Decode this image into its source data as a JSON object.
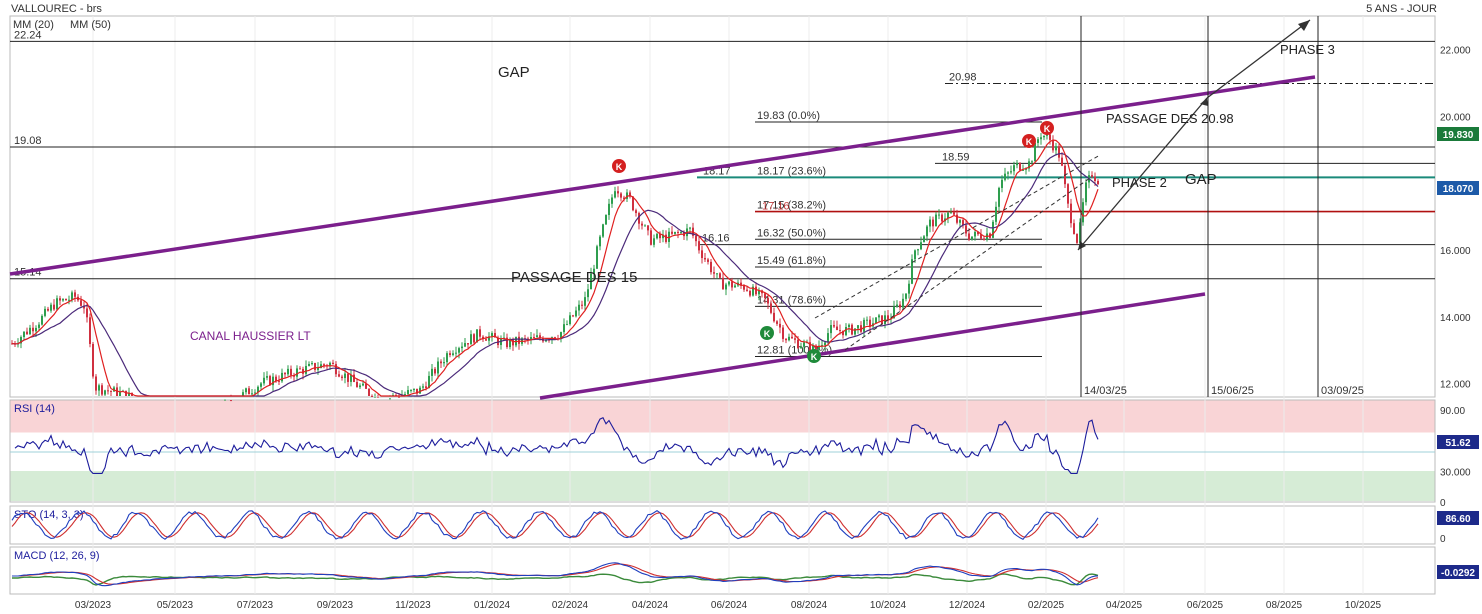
{
  "header": {
    "symbol": "VALLOUREC - brs",
    "period": "5 ANS - JOUR",
    "ma20_label": "MM (20)",
    "ma50_label": "MM (50)"
  },
  "colors": {
    "ma20": "#e02020",
    "ma50": "#4b2a7a",
    "channel": "#7b1f8c",
    "fib_line": "#1a8a7a",
    "red_line": "#b01010",
    "rsi": "#1c1c9c",
    "stoch_k": "#1f3fbf",
    "stoch_d": "#d03030",
    "macd": "#1f3fbf",
    "signal": "#d03030",
    "hist": "#3a8a3a",
    "up": "#2e9e4e",
    "down": "#d03040"
  },
  "chart_data": {
    "type": "candlestick",
    "price_axis": {
      "ylim": [
        11.6,
        23.0
      ],
      "ticks": [
        "22.000",
        "20.000",
        "16.000",
        "14.000",
        "12.000"
      ],
      "tick_values": [
        22,
        20,
        16,
        14,
        12
      ]
    },
    "x_axis": {
      "ticks": [
        "03/2023",
        "05/2023",
        "07/2023",
        "09/2023",
        "11/2023",
        "01/2024",
        "02/2024",
        "04/2024",
        "06/2024",
        "08/2024",
        "10/2024",
        "12/2024",
        "02/2025",
        "04/2025",
        "06/2025",
        "08/2025",
        "10/2025"
      ]
    },
    "last_price": "18.070",
    "resistance_label": "19.830",
    "horizontal_levels": [
      {
        "value": 22.24,
        "label": "22.24"
      },
      {
        "value": 19.08,
        "label": "19.08"
      },
      {
        "value": 15.14,
        "label": "15.14"
      }
    ],
    "fibonacci": [
      {
        "value": 19.83,
        "label": "19.83  (0.0%)"
      },
      {
        "value": 18.17,
        "label": "18.17  (23.6%)"
      },
      {
        "value": 17.15,
        "label": "17.15  (38.2%)"
      },
      {
        "value": 16.32,
        "label": "16.32  (50.0%)"
      },
      {
        "value": 15.49,
        "label": "15.49  (61.8%)"
      },
      {
        "value": 14.31,
        "label": "14.31  (78.6%)"
      },
      {
        "value": 12.81,
        "label": "12.81  (100.0%)"
      }
    ],
    "fib_overlap_label": "17.16",
    "level_2098": "20.98",
    "level_1859": "18.59",
    "level_1817": "18.17",
    "level_1616": "16.16",
    "annotations": {
      "gap1": "GAP",
      "gap2": "GAP",
      "passage15": "PASSAGE DES 15",
      "passage2098": "PASSAGE DES 20.98",
      "phase2": "PHASE 2",
      "phase3": "PHASE 3",
      "canal": "CANAL HAUSSIER LT",
      "k_marker": "K"
    },
    "date_marks": [
      "14/03/25",
      "15/06/25",
      "03/09/25"
    ],
    "rsi": {
      "label": "RSI (14)",
      "ticks": [
        "90.00",
        "30.000",
        "0"
      ],
      "tick_values": [
        90,
        30,
        0
      ],
      "last": "51.62"
    },
    "stoch": {
      "label": "STO (14, 3, 3)",
      "ticks": [
        "0"
      ],
      "last": "86.60"
    },
    "macd": {
      "label": "MACD (12, 26, 9)",
      "last": "-0.0292"
    }
  }
}
